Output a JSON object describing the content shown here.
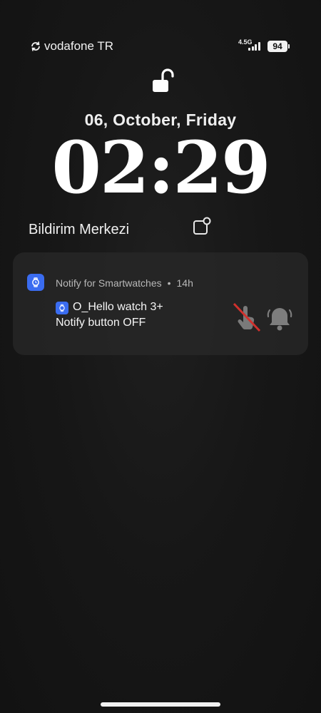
{
  "status_bar": {
    "carrier": "vodafone TR",
    "network": "4.5G",
    "battery": "94"
  },
  "lockscreen": {
    "date": "06, October, Friday",
    "time": "02:29"
  },
  "notification_center": {
    "title": "Bildirim Merkezi"
  },
  "notification": {
    "app_name": "Notify for Smartwatches",
    "separator": "•",
    "age": "14h",
    "title": "O_Hello watch 3+",
    "body": "Notify button OFF",
    "accent_color": "#3a6cf0"
  }
}
